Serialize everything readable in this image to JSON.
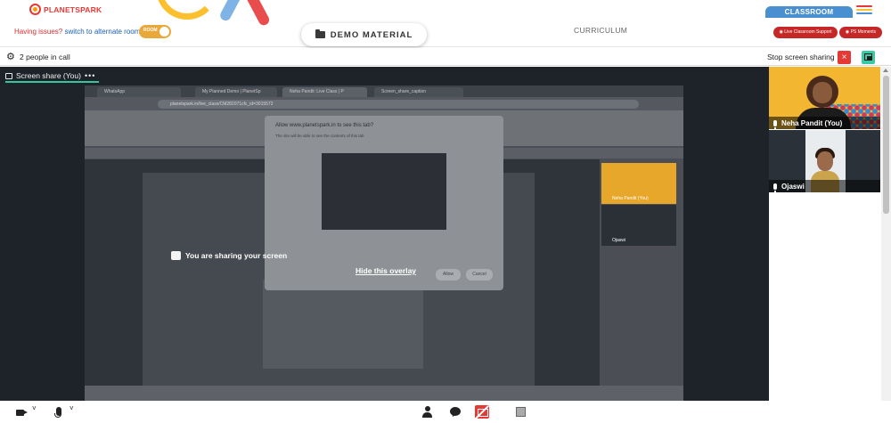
{
  "header": {
    "logo_text": "PLANETSPARK",
    "issue_label": "Having issues?",
    "issue_link": "switch to alternate room",
    "room_toggle_label": "ROOM",
    "demo_material_label": "DEMO MATERIAL",
    "curriculum_label": "CURRICULUM",
    "classroom_tab_label": "CLASSROOM",
    "live_support_label": "Live Classroom Support",
    "ps_moments_label": "PS Moments",
    "hamburger_colors": [
      "#e53935",
      "#fbc02d",
      "#4a90d0"
    ]
  },
  "callbar": {
    "people_in_call": "2 people in call",
    "stop_sharing_label": "Stop screen sharing",
    "stop_icon": "×"
  },
  "stage": {
    "share_tab_label": "Screen share (You)",
    "share_tab_more": "•••",
    "shared_tabs": [
      "WhatsApp",
      "My Planned Demo | PlanetSp",
      "Neha Pandit: Live Class | P",
      "Screen_share_caption"
    ],
    "shared_url": "planetspark.in/live_class/CM282071cfc_id=3015572",
    "dialog_title": "Allow www.planetspark.in to see this tab?",
    "dialog_sub": "The site will be able to see the contents of this tab",
    "dialog_allow": "Allow",
    "dialog_cancel": "Cancel",
    "overlay_text": "You are sharing your screen",
    "overlay_link": "Hide this overlay",
    "mini_video_1_name": "Neha Pandit (You)",
    "mini_video_2_name": "Ojaswi"
  },
  "videos": [
    {
      "name": "Neha Pandit (You)"
    },
    {
      "name": "Ojaswi"
    }
  ],
  "toolbar": {
    "chevron": "˅"
  },
  "colors": {
    "accent_green": "#38c49c",
    "danger_red": "#e53935",
    "classroom_blue": "#4a90d0",
    "stage_bg": "#1e2329"
  }
}
